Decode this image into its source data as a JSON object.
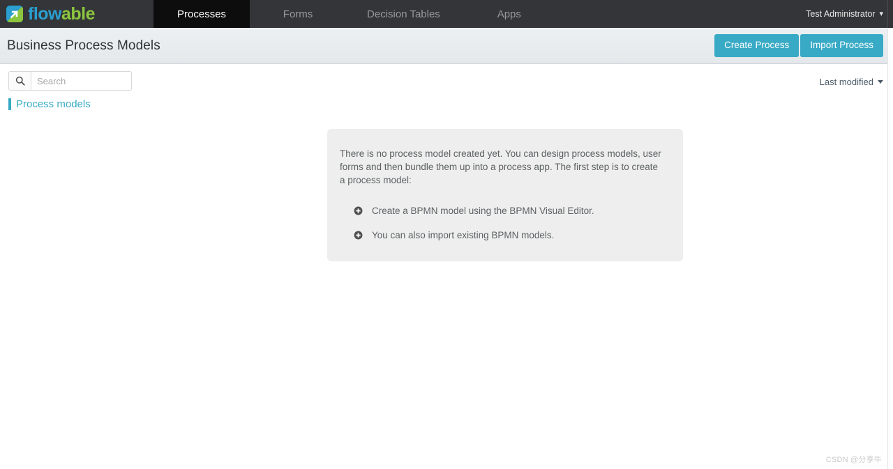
{
  "navbar": {
    "brand": {
      "icon": "flowable-logo-icon",
      "text_primary": "flow",
      "text_secondary": "able"
    },
    "tabs": [
      {
        "label": "Processes",
        "active": true
      },
      {
        "label": "Forms",
        "active": false
      },
      {
        "label": "Decision Tables",
        "active": false
      },
      {
        "label": "Apps",
        "active": false
      }
    ],
    "user_menu": {
      "label": "Test Administrator",
      "caret_icon": "chevron-down-icon"
    }
  },
  "subheader": {
    "title": "Business Process Models",
    "create_button": "Create Process",
    "import_button": "Import Process"
  },
  "toolbar": {
    "search": {
      "icon": "search-icon",
      "value": "",
      "placeholder": "Search"
    },
    "sort": {
      "label": "Last modified",
      "caret_icon": "caret-down-icon"
    }
  },
  "section": {
    "link_label": "Process models"
  },
  "empty_state": {
    "paragraph": "There is no process model created yet. You can design process models, user forms and then bundle them up into a process app. The first step is to create a process model:",
    "items": [
      {
        "icon": "plus-circle-icon",
        "label": "Create a BPMN model using the BPMN Visual Editor."
      },
      {
        "icon": "plus-circle-icon",
        "label": "You can also import existing BPMN models."
      }
    ]
  },
  "watermark": {
    "text": "CSDN @分享牛"
  },
  "colors": {
    "navbar_bg": "#333538",
    "navbar_active_bg": "#0d0d0d",
    "accent_teal": "#38aac5",
    "brand_blue": "#2a9fd0",
    "brand_green": "#8cc63e",
    "subheader_bg": "#e8ebee",
    "panel_bg": "#eeeeee"
  }
}
